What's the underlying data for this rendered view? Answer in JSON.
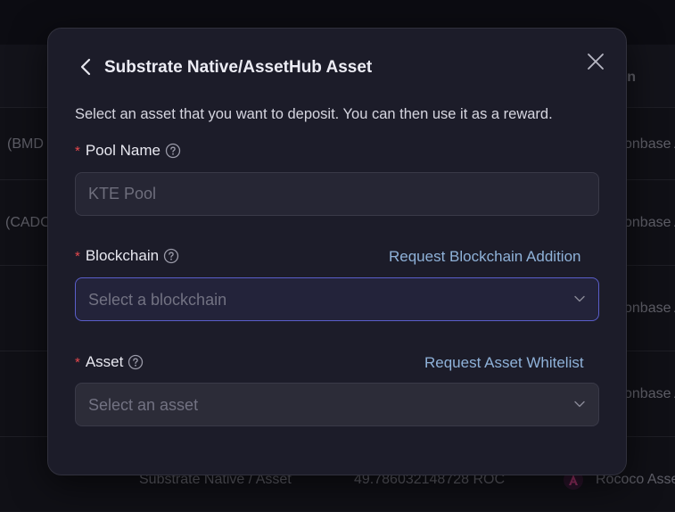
{
  "background": {
    "header_col": "n",
    "rows": [
      {
        "left": "(BMD",
        "right": "onbase A"
      },
      {
        "left": "(CADC",
        "right": "onbase A"
      },
      {
        "left": "",
        "right": "onbase A"
      },
      {
        "left": "",
        "right": "onbase A"
      }
    ],
    "bottom_row": {
      "type": "Substrate Native / Asset",
      "amount": "49.786032148728 ROC",
      "chain": "Rococo Asse"
    }
  },
  "modal": {
    "title": "Substrate Native/AssetHub Asset",
    "description": "Select an asset that you want to deposit. You can then use it as a reward.",
    "pool_name": {
      "label": "Pool Name",
      "placeholder": "KTE Pool",
      "required_mark": "*"
    },
    "blockchain": {
      "label": "Blockchain",
      "placeholder": "Select a blockchain",
      "link": "Request Blockchain Addition",
      "required_mark": "*"
    },
    "asset": {
      "label": "Asset",
      "placeholder": "Select an asset",
      "link": "Request Asset Whitelist",
      "required_mark": "*"
    }
  },
  "icons": {
    "back": "chevron-left-icon",
    "close": "close-icon",
    "help": "help-circle-icon",
    "dropdown": "chevron-down-icon"
  },
  "colors": {
    "required": "#e5484d",
    "link": "#8fb2d9",
    "focus_border": "#5a5ec9"
  }
}
